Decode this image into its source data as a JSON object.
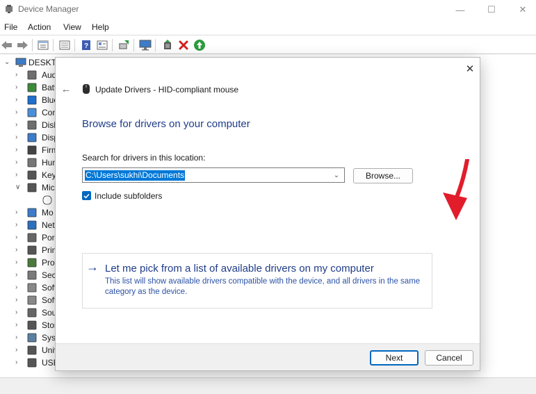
{
  "window": {
    "title": "Device Manager",
    "controls": {
      "minimize": "—",
      "maximize": "☐",
      "close": "✕"
    }
  },
  "menu": [
    "File",
    "Action",
    "View",
    "Help"
  ],
  "toolbar": {
    "buttons": [
      "back-arrow-icon",
      "forward-arrow-icon",
      "properties-icon",
      "show-hidden-icon",
      "help-icon",
      "view-icon",
      "update-driver-icon",
      "scan-hardware-icon",
      "add-driver-icon",
      "uninstall-icon",
      "enable-device-icon"
    ]
  },
  "tree": {
    "root": "DESKTO",
    "items": [
      {
        "label": "Aud",
        "icon": "audio-icon",
        "chevron": ">"
      },
      {
        "label": "Batt",
        "icon": "battery-icon",
        "chevron": ">"
      },
      {
        "label": "Blue",
        "icon": "bluetooth-icon",
        "chevron": ">"
      },
      {
        "label": "Con",
        "icon": "computer-icon",
        "chevron": ">"
      },
      {
        "label": "Disk",
        "icon": "disk-icon",
        "chevron": ">"
      },
      {
        "label": "Disp",
        "icon": "display-icon",
        "chevron": ">"
      },
      {
        "label": "Firm",
        "icon": "firmware-icon",
        "chevron": ">"
      },
      {
        "label": "Hum",
        "icon": "hid-icon",
        "chevron": ">"
      },
      {
        "label": "Key",
        "icon": "keyboard-icon",
        "chevron": ">"
      },
      {
        "label": "Mic",
        "icon": "mouse-icon",
        "chevron": "v"
      },
      {
        "label": "",
        "icon": "hid-mouse-icon",
        "chevron": ""
      },
      {
        "label": "Mo",
        "icon": "monitor-icon",
        "chevron": ">"
      },
      {
        "label": "Net",
        "icon": "network-icon",
        "chevron": ">"
      },
      {
        "label": "Por",
        "icon": "port-icon",
        "chevron": ">"
      },
      {
        "label": "Prin",
        "icon": "printer-icon",
        "chevron": ">"
      },
      {
        "label": "Pro",
        "icon": "processor-icon",
        "chevron": ">"
      },
      {
        "label": "Sec",
        "icon": "security-icon",
        "chevron": ">"
      },
      {
        "label": "Soft",
        "icon": "software-component-icon",
        "chevron": ">"
      },
      {
        "label": "Soft",
        "icon": "software-device-icon",
        "chevron": ">"
      },
      {
        "label": "Sou",
        "icon": "sound-icon",
        "chevron": ">"
      },
      {
        "label": "Stor",
        "icon": "storage-icon",
        "chevron": ">"
      },
      {
        "label": "Syst",
        "icon": "system-icon",
        "chevron": ">"
      },
      {
        "label": "Univ",
        "icon": "universal-serial-icon",
        "chevron": ">"
      },
      {
        "label": "USB",
        "icon": "usb-icon",
        "chevron": ">"
      }
    ]
  },
  "dialog": {
    "title": "Update Drivers - HID-compliant mouse",
    "heading": "Browse for drivers on your computer",
    "search_label": "Search for drivers in this location:",
    "path_value": "C:\\Users\\sukhi\\Documents",
    "browse_label": "Browse...",
    "include_subfolders_label": "Include subfolders",
    "include_subfolders_checked": true,
    "pick_title": "Let me pick from a list of available drivers on my computer",
    "pick_desc": "This list will show available drivers compatible with the device, and all drivers in the same category as the device.",
    "next_label": "Next",
    "cancel_label": "Cancel",
    "close": "✕",
    "back": "←"
  },
  "colors": {
    "accent": "#0067c0",
    "heading_blue": "#1f3c88",
    "link_blue": "#2b52a6",
    "annotation_red": "#e11d2b"
  }
}
